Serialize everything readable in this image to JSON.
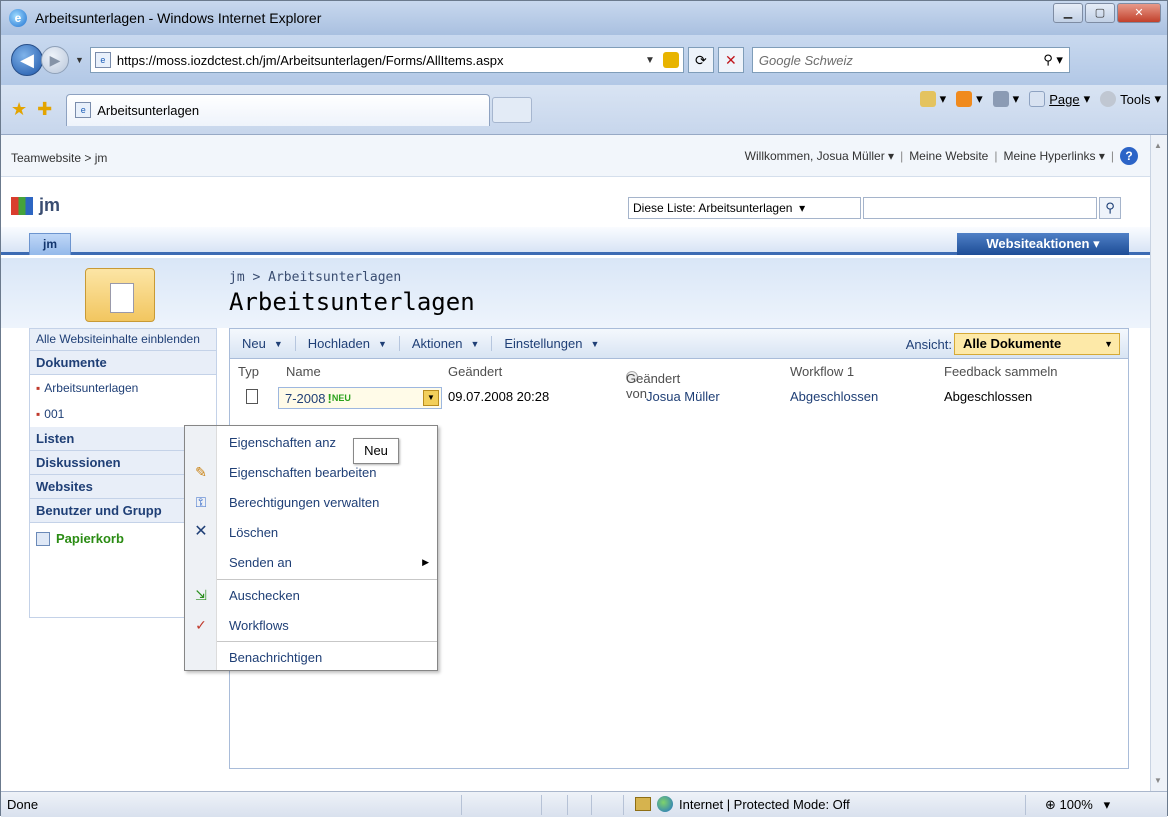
{
  "browser": {
    "title": "Arbeitsunterlagen - Windows Internet Explorer",
    "url": "https://moss.iozdctest.ch/jm/Arbeitsunterlagen/Forms/AllItems.aspx",
    "search_placeholder": "Google Schweiz",
    "tab_title": "Arbeitsunterlagen",
    "commands": {
      "page": "Page",
      "tools": "Tools"
    },
    "status": "Done",
    "zone": "Internet | Protected Mode: Off",
    "zoom": "100%"
  },
  "topbar": {
    "breadcrumb": "Teamwebsite > jm",
    "welcome": "Willkommen, Josua Müller",
    "my_site": "Meine Website",
    "my_links": "Meine Hyperlinks"
  },
  "site": {
    "name": "jm",
    "scope": "Diese Liste: Arbeitsunterlagen",
    "tab": "jm",
    "site_actions": "Websiteaktionen"
  },
  "page": {
    "breadcrumb": "jm > Arbeitsunterlagen",
    "title": "Arbeitsunterlagen"
  },
  "quicklaunch": {
    "all_content": "Alle Websiteinhalte einblenden",
    "documents": "Dokumente",
    "doc_items": [
      "Arbeitsunterlagen",
      "001"
    ],
    "lists": "Listen",
    "discussions": "Diskussionen",
    "websites": "Websites",
    "people": "Benutzer und Grupp",
    "recycle": "Papierkorb"
  },
  "toolbar": {
    "new": "Neu",
    "upload": "Hochladen",
    "actions": "Aktionen",
    "settings": "Einstellungen",
    "view_label": "Ansicht:",
    "view_value": "Alle Dokumente"
  },
  "columns": [
    "Typ",
    "Name",
    "Geändert",
    "Geändert von",
    "Workflow 1",
    "Feedback sammeln"
  ],
  "row": {
    "name": "7-2008",
    "new_badge": "NEU",
    "modified": "09.07.2008 20:28",
    "modified_by": "Josua Müller",
    "workflow": "Abgeschlossen",
    "feedback": "Abgeschlossen"
  },
  "context_menu": {
    "items": [
      "Eigenschaften anzeigen",
      "Eigenschaften bearbeiten",
      "Berechtigungen verwalten",
      "Löschen",
      "Senden an",
      "Auschecken",
      "Workflows",
      "Benachrichtigen"
    ],
    "first_visible": "Eigenschaften anz"
  },
  "tooltip": "Neu"
}
